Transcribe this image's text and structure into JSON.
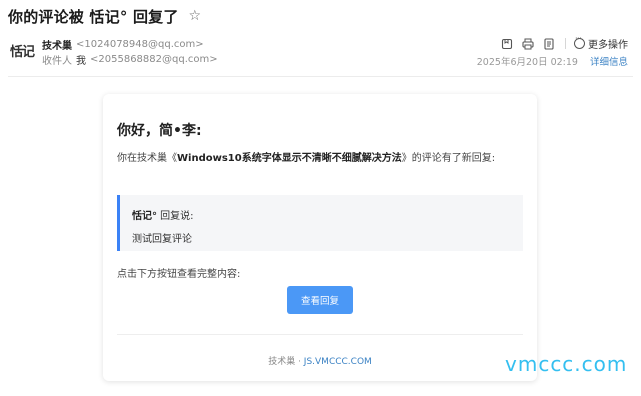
{
  "email": {
    "subject": "你的评论被 恬记° 回复了",
    "star_icon": "☆",
    "sender": {
      "avatar_text": "恬记",
      "name": "技术巢",
      "address": "<1024078948@qq.com>"
    },
    "recipient": {
      "label": "收件人",
      "name": "我",
      "address": "<2055868882@qq.com>"
    },
    "date": "2025年6月20日 02:19",
    "details_link": "详细信息",
    "more_actions": "更多操作",
    "icons": [
      "tag-icon",
      "print-icon",
      "note-icon",
      "more-icon"
    ]
  },
  "card": {
    "greeting": "你好，简•李:",
    "intro_prefix": "你在技术巢《",
    "intro_title": "Windows10系统字体显示不清晰不细腻解决方法",
    "intro_suffix": "》的评论有了新回复:",
    "quote_author": "恬记°",
    "quote_said": " 回复说:",
    "quote_text": "测试回复评论",
    "hint": "点击下方按钮查看完整内容:",
    "button_label": "查看回复",
    "footer_site": "技术巢 · ",
    "footer_link": "JS.VMCCC.COM"
  },
  "watermark": "vmccc.com",
  "colors": {
    "accent": "#4b98f6",
    "link": "#3b82c4",
    "quote_border": "#3b82f6",
    "watermark": "#34bff0"
  }
}
